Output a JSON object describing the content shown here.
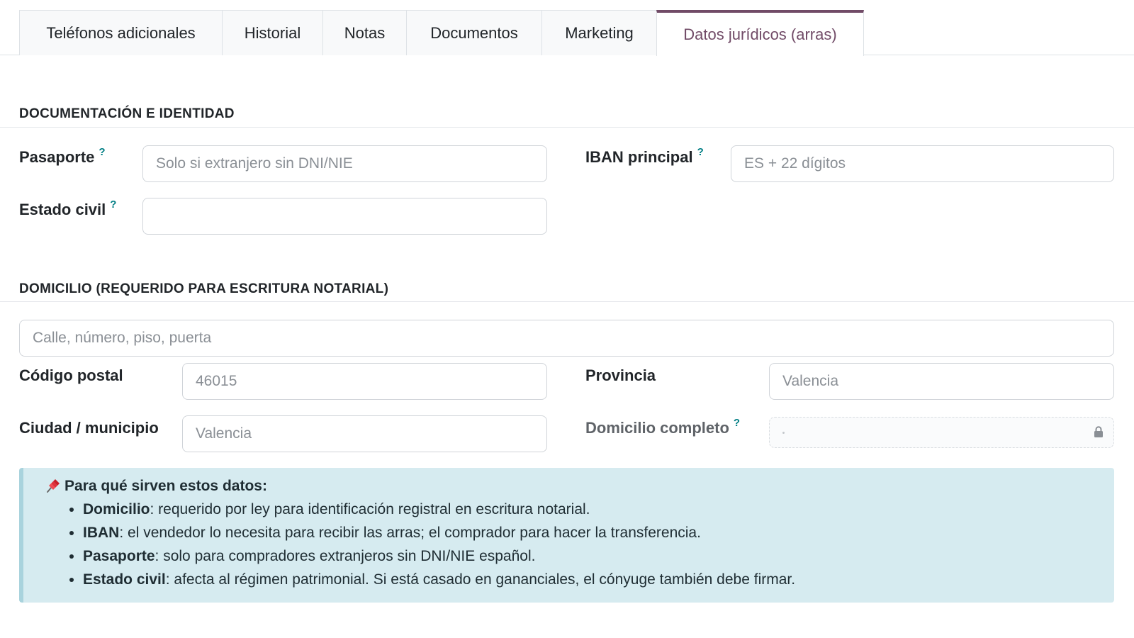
{
  "tabs": [
    {
      "label": "Teléfonos adicionales",
      "active": false
    },
    {
      "label": "Historial",
      "active": false
    },
    {
      "label": "Notas",
      "active": false
    },
    {
      "label": "Documentos",
      "active": false
    },
    {
      "label": "Marketing",
      "active": false
    },
    {
      "label": "Datos jurídicos (arras)",
      "active": true
    }
  ],
  "colors": {
    "accent": "#714b67",
    "help": "#017e84",
    "info_bg": "#d6ebf0"
  },
  "identity": {
    "title": "DOCUMENTACIÓN E IDENTIDAD",
    "passport_label": "Pasaporte",
    "passport_placeholder": "Solo si extranjero sin DNI/NIE",
    "passport_value": "",
    "iban_label": "IBAN principal",
    "iban_placeholder": "ES + 22 dígitos",
    "iban_value": "",
    "civil_label": "Estado civil",
    "civil_value": "",
    "help_mark": "?"
  },
  "address": {
    "title": "DOMICILIO (REQUERIDO PARA ESCRITURA NOTARIAL)",
    "street_placeholder": "Calle, número, piso, puerta",
    "street_value": "",
    "postal_label": "Código postal",
    "postal_placeholder": "46015",
    "province_label": "Provincia",
    "province_placeholder": "Valencia",
    "city_label": "Ciudad / municipio",
    "city_placeholder": "Valencia",
    "full_label": "Domicilio completo",
    "full_icon": "lock-icon"
  },
  "info": {
    "icon": "pushpin-icon",
    "title": "Para qué sirven estos datos:",
    "items": [
      {
        "term": "Domicilio",
        "text": ": requerido por ley para identificación registral en escritura notarial."
      },
      {
        "term": "IBAN",
        "text": ": el vendedor lo necesita para recibir las arras; el comprador para hacer la transferencia."
      },
      {
        "term": "Pasaporte",
        "text": ": solo para compradores extranjeros sin DNI/NIE español."
      },
      {
        "term": "Estado civil",
        "text": ": afecta al régimen patrimonial. Si está casado en gananciales, el cónyuge también debe firmar."
      }
    ]
  }
}
